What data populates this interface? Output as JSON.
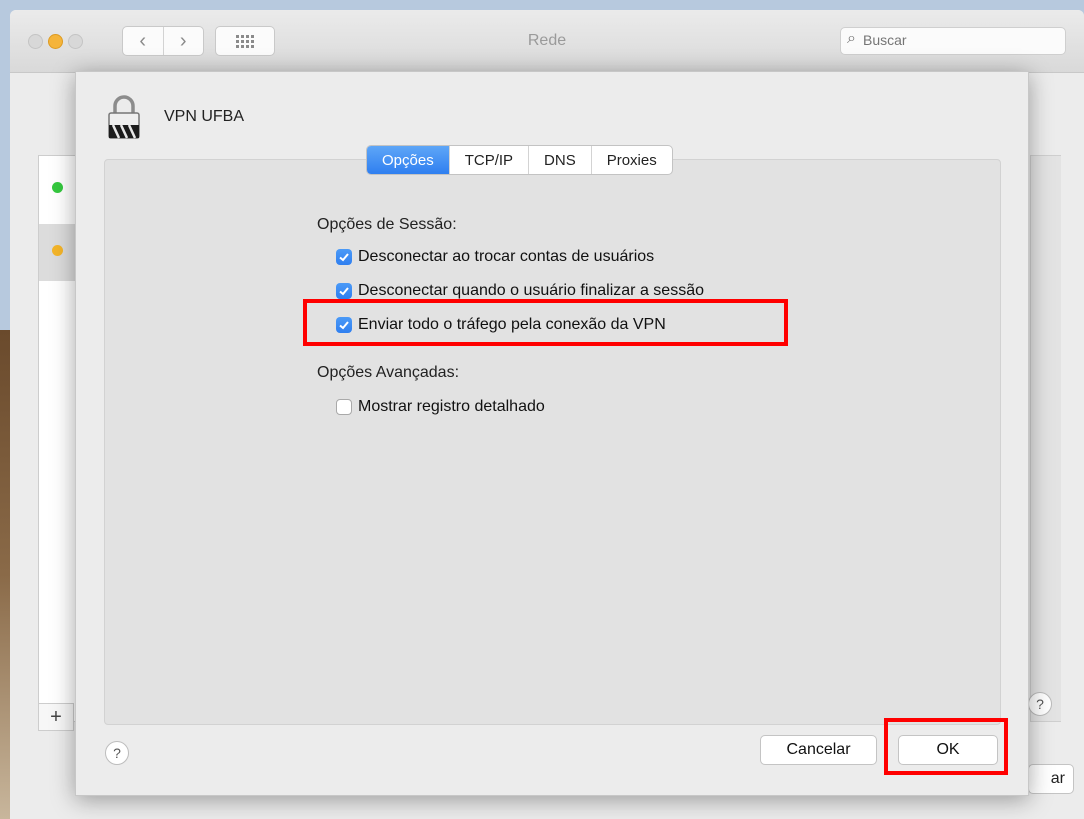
{
  "window": {
    "title": "Rede"
  },
  "search": {
    "placeholder": "Buscar",
    "icon": "search-icon"
  },
  "toolbar": {
    "back_icon": "‹",
    "forward_icon": "›"
  },
  "background": {
    "add_label": "+",
    "help_label": "?",
    "apply_partial": "ar"
  },
  "sheet": {
    "connection_name": "VPN UFBA",
    "tabs": [
      {
        "label": "Opções",
        "active": true
      },
      {
        "label": "TCP/IP",
        "active": false
      },
      {
        "label": "DNS",
        "active": false
      },
      {
        "label": "Proxies",
        "active": false
      }
    ],
    "session_section": {
      "label": "Opções de Sessão:",
      "options": [
        {
          "label": "Desconectar ao trocar contas de usuários",
          "checked": true
        },
        {
          "label": "Desconectar quando o usuário finalizar a sessão",
          "checked": true
        },
        {
          "label": "Enviar todo o tráfego pela conexão da VPN",
          "checked": true
        }
      ]
    },
    "advanced_section": {
      "label": "Opções Avançadas:",
      "options": [
        {
          "label": "Mostrar registro detalhado",
          "checked": false
        }
      ]
    },
    "help_label": "?",
    "cancel_label": "Cancelar",
    "ok_label": "OK"
  },
  "colors": {
    "accent": "#2f7ff0",
    "highlight": "#ff0000",
    "status_connected": "#35c93f",
    "status_pending": "#f4b529"
  }
}
